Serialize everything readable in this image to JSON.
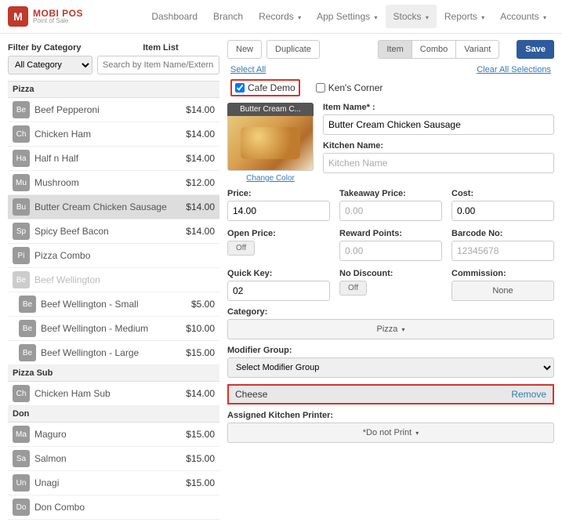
{
  "brand": {
    "name": "MOBI POS",
    "sub": "Point of Sale",
    "logoLetter": "M"
  },
  "nav": {
    "items": [
      "Dashboard",
      "Branch",
      "Records",
      "App Settings",
      "Stocks",
      "Reports",
      "Accounts"
    ],
    "dropdowns": [
      false,
      false,
      true,
      true,
      true,
      true,
      true
    ],
    "activeIndex": 4
  },
  "left": {
    "filterLabel": "Filter by Category",
    "itemListLabel": "Item List",
    "categorySelect": "All Category",
    "searchPlaceholder": "Search by Item Name/External ID",
    "groups": [
      {
        "name": "Pizza",
        "items": [
          {
            "sq": "Be",
            "name": "Beef Pepperoni",
            "price": "$14.00"
          },
          {
            "sq": "Ch",
            "name": "Chicken Ham",
            "price": "$14.00"
          },
          {
            "sq": "Ha",
            "name": "Half n Half",
            "price": "$14.00"
          },
          {
            "sq": "Mu",
            "name": "Mushroom",
            "price": "$12.00"
          },
          {
            "sq": "Bu",
            "name": "Butter Cream Chicken Sausage",
            "price": "$14.00",
            "selected": true
          },
          {
            "sq": "Sp",
            "name": "Spicy Beef Bacon",
            "price": "$14.00"
          },
          {
            "sq": "Pi",
            "name": "Pizza Combo",
            "price": ""
          },
          {
            "sq": "Be",
            "name": "Beef Wellington",
            "price": "",
            "muted": true,
            "light": true
          },
          {
            "sq": "Be",
            "name": "Beef Wellington - Small",
            "price": "$5.00",
            "indent": true
          },
          {
            "sq": "Be",
            "name": "Beef Wellington - Medium",
            "price": "$10.00",
            "indent": true
          },
          {
            "sq": "Be",
            "name": "Beef Wellington - Large",
            "price": "$15.00",
            "indent": true
          }
        ]
      },
      {
        "name": "Pizza Sub",
        "items": [
          {
            "sq": "Ch",
            "name": "Chicken Ham Sub",
            "price": "$14.00"
          }
        ]
      },
      {
        "name": "Don",
        "items": [
          {
            "sq": "Ma",
            "name": "Maguro",
            "price": "$15.00"
          },
          {
            "sq": "Sa",
            "name": "Salmon",
            "price": "$15.00"
          },
          {
            "sq": "Un",
            "name": "Unagi",
            "price": "$15.00"
          },
          {
            "sq": "Do",
            "name": "Don Combo",
            "price": ""
          }
        ]
      }
    ]
  },
  "actions": {
    "new": "New",
    "duplicate": "Duplicate",
    "seg": [
      "Item",
      "Combo",
      "Variant"
    ],
    "segActive": 0,
    "save": "Save"
  },
  "selection": {
    "selectAll": "Select All",
    "clearAll": "Clear All Selections",
    "branches": [
      {
        "label": "Cafe Demo",
        "checked": true,
        "highlight": true
      },
      {
        "label": "Ken's Corner",
        "checked": false
      }
    ]
  },
  "detail": {
    "thumbCaption": "Butter Cream C...",
    "changeColor": "Change Color",
    "itemNameLabel": "Item Name* :",
    "itemName": "Butter Cream Chicken Sausage",
    "kitchenNameLabel": "Kitchen Name:",
    "kitchenNamePlaceholder": "Kitchen Name",
    "priceLabel": "Price:",
    "price": "14.00",
    "takeawayLabel": "Takeaway Price:",
    "takeawayPlaceholder": "0.00",
    "costLabel": "Cost:",
    "cost": "0.00",
    "openPriceLabel": "Open Price:",
    "openPrice": "Off",
    "rewardLabel": "Reward Points:",
    "rewardPlaceholder": "0.00",
    "barcodeLabel": "Barcode No:",
    "barcodePlaceholder": "12345678",
    "quickKeyLabel": "Quick Key:",
    "quickKey": "02",
    "noDiscountLabel": "No Discount:",
    "noDiscount": "Off",
    "commissionLabel": "Commission:",
    "commission": "None",
    "categoryLabel": "Category:",
    "category": "Pizza",
    "modGroupLabel": "Modifier Group:",
    "modGroupSelect": "Select Modifier Group",
    "modifier": {
      "name": "Cheese",
      "remove": "Remove"
    },
    "printerLabel": "Assigned Kitchen Printer:",
    "printer": "*Do not Print"
  }
}
